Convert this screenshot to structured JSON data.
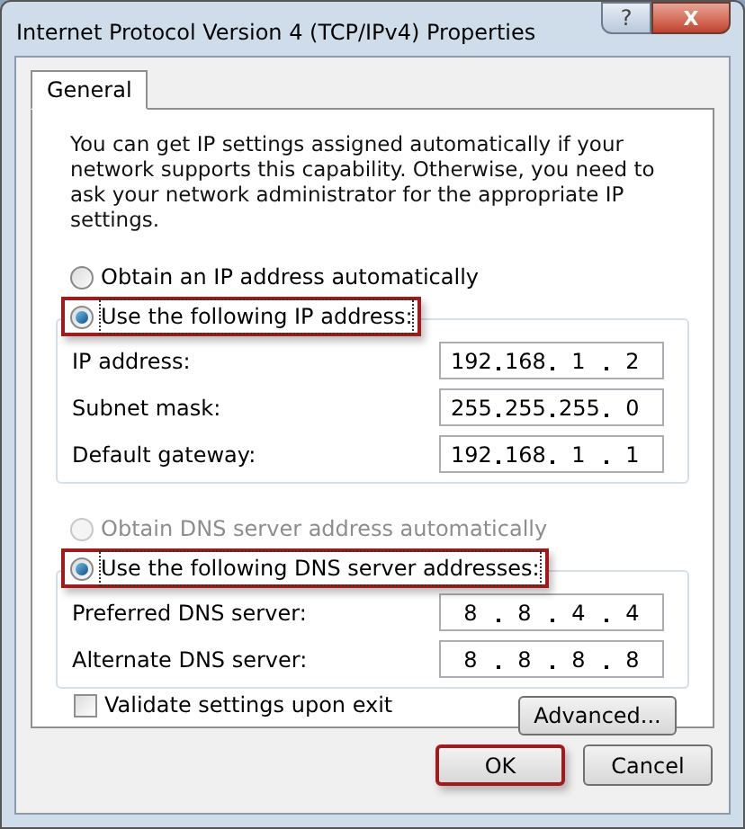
{
  "window": {
    "title": "Internet Protocol Version 4 (TCP/IPv4) Properties",
    "help": "?",
    "close": "X"
  },
  "tabs": [
    {
      "label": "General",
      "selected": true
    }
  ],
  "intro": "You can get IP settings assigned automatically if your network supports this capability. Otherwise, you need to ask your network administrator for the appropriate IP settings.",
  "sections": [
    {
      "options": [
        {
          "label": "Obtain an IP address automatically",
          "selected": false,
          "disabled": false,
          "highlighted": false
        },
        {
          "label": "Use the following IP address:",
          "selected": true,
          "disabled": false,
          "highlighted": true
        }
      ],
      "fields": [
        {
          "label": "IP address:",
          "octets": [
            "192",
            "168",
            "1",
            "2"
          ]
        },
        {
          "label": "Subnet mask:",
          "octets": [
            "255",
            "255",
            "255",
            "0"
          ]
        },
        {
          "label": "Default gateway:",
          "octets": [
            "192",
            "168",
            "1",
            "1"
          ]
        }
      ]
    },
    {
      "options": [
        {
          "label": "Obtain DNS server address automatically",
          "selected": false,
          "disabled": true,
          "highlighted": false
        },
        {
          "label": "Use the following DNS server addresses:",
          "selected": true,
          "disabled": false,
          "highlighted": true
        }
      ],
      "fields": [
        {
          "label": "Preferred DNS server:",
          "octets": [
            "8",
            "8",
            "4",
            "4"
          ]
        },
        {
          "label": "Alternate DNS server:",
          "octets": [
            "8",
            "8",
            "8",
            "8"
          ]
        }
      ]
    }
  ],
  "validate": {
    "label": "Validate settings upon exit",
    "checked": false
  },
  "advanced_button": "Advanced...",
  "buttons": [
    {
      "label": "OK",
      "highlighted": true
    },
    {
      "label": "Cancel",
      "highlighted": false
    }
  ]
}
